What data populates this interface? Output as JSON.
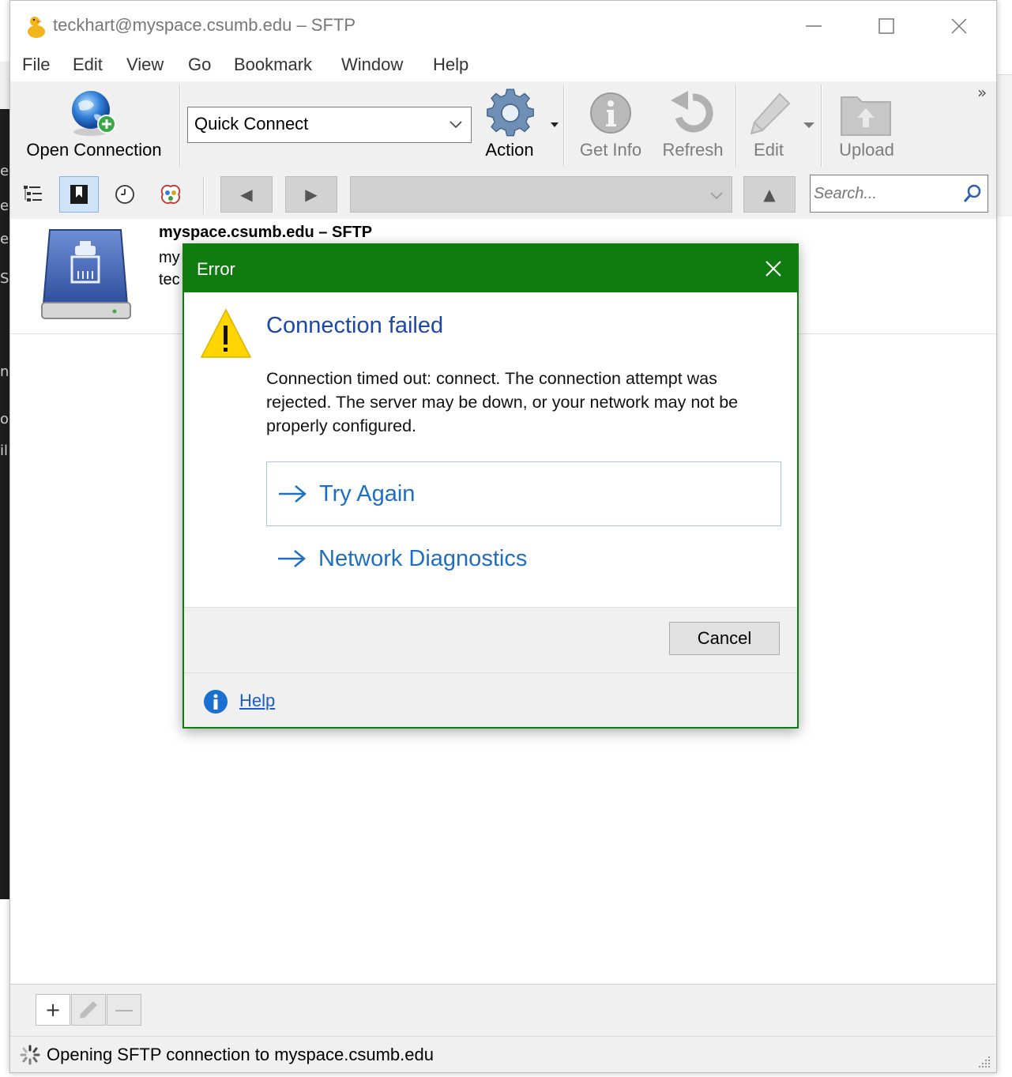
{
  "window": {
    "title": "teckhart@myspace.csumb.edu – SFTP",
    "minimize": "—",
    "maximize": "☐",
    "close": "✕"
  },
  "menu": [
    "File",
    "Edit",
    "View",
    "Go",
    "Bookmark",
    "Window",
    "Help"
  ],
  "toolbar": {
    "open_connection": "Open Connection",
    "quick_connect": "Quick Connect",
    "action": "Action",
    "get_info": "Get Info",
    "refresh": "Refresh",
    "edit": "Edit",
    "upload": "Upload",
    "overflow": "»"
  },
  "navbar": {
    "back": "◀",
    "forward": "▶",
    "up": "▲",
    "search_placeholder": "Search..."
  },
  "bookmark": {
    "name": "myspace.csumb.edu – SFTP",
    "line2": "my",
    "line3": "tec"
  },
  "dialog": {
    "title": "Error",
    "heading": "Connection failed",
    "message": "Connection timed out: connect. The connection attempt was rejected. The server may be down, or your network may not be properly configured.",
    "try_again": "Try Again",
    "network_diagnostics": "Network Diagnostics",
    "cancel": "Cancel",
    "help": "Help"
  },
  "bottombar": {
    "add": "+",
    "remove": "—"
  },
  "status": {
    "text": "Opening SFTP connection to myspace.csumb.edu"
  },
  "background_fragments": [
    "ec",
    "ec",
    "er",
    "Se",
    "ne",
    "or",
    "il"
  ],
  "colors": {
    "dialog_accent": "#107c10",
    "heading_blue": "#1f47a8",
    "link_blue": "#1f6fc0",
    "warning_yellow": "#ffd500"
  }
}
